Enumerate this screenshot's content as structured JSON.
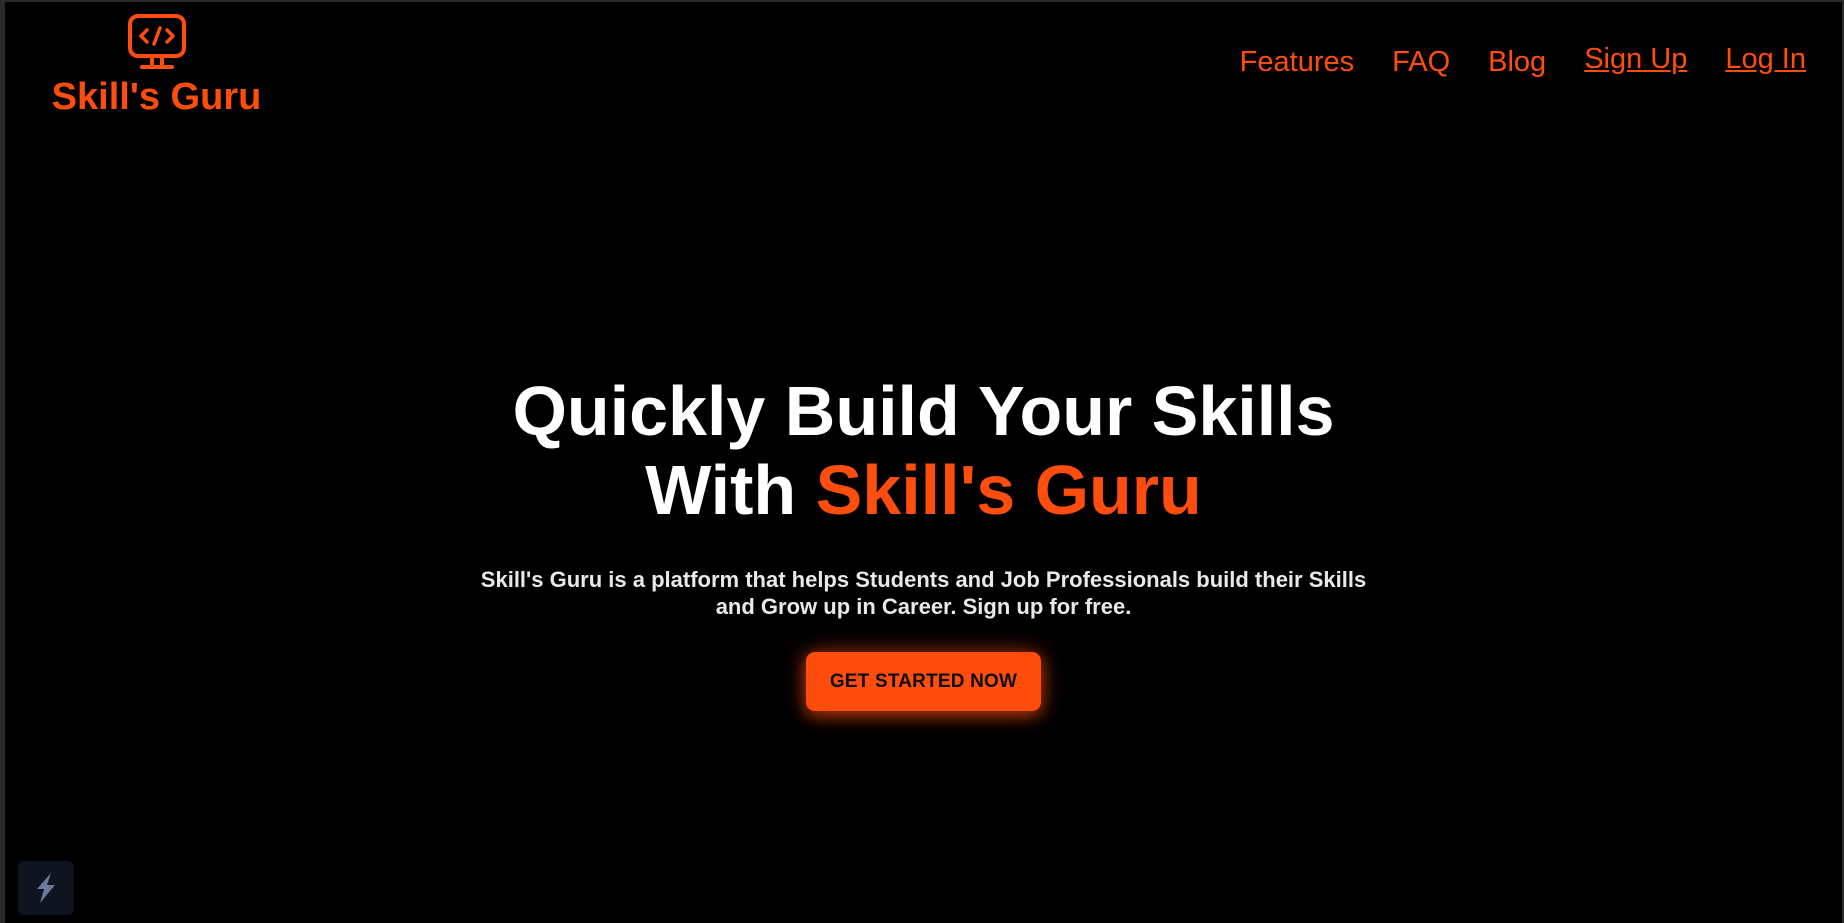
{
  "brand": {
    "name": "Skill's Guru",
    "icon": "monitor-code-icon"
  },
  "nav": {
    "items": [
      {
        "label": "Features"
      },
      {
        "label": "FAQ"
      },
      {
        "label": "Blog"
      },
      {
        "label": "Sign Up"
      },
      {
        "label": "Log In"
      }
    ]
  },
  "hero": {
    "title_line1": "Quickly Build Your Skills",
    "title_line2_prefix": "With ",
    "title_line2_accent": "Skill's Guru",
    "subtitle": "Skill's Guru is a platform that helps Students and Job Professionals build their Skills and Grow up in Career. Sign up for free.",
    "cta_label": "GET STARTED NOW"
  },
  "corner_widget": {
    "icon": "lightning-s-icon"
  },
  "colors": {
    "accent": "#ff4d0d",
    "background": "#000000",
    "text": "#ffffff"
  }
}
